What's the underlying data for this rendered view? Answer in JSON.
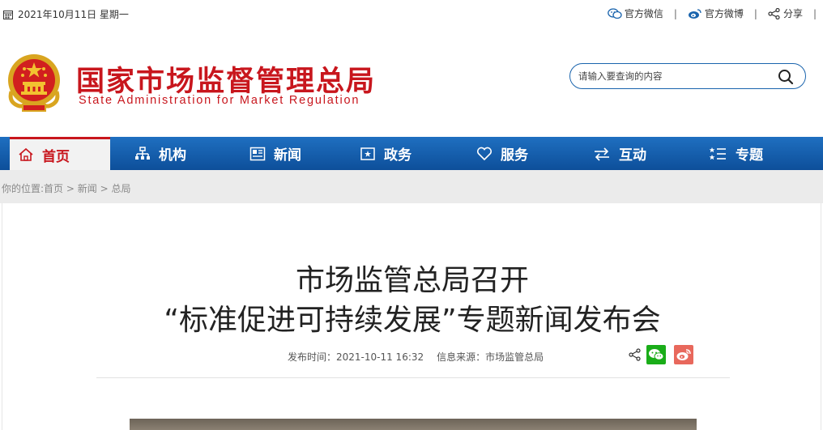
{
  "topbar": {
    "date": "2021年10月11日 星期一",
    "links": [
      {
        "label": "官方微信",
        "icon": "wechat-icon"
      },
      {
        "label": "官方微博",
        "icon": "weibo-icon"
      },
      {
        "label": "分享",
        "icon": "share-icon"
      }
    ],
    "separator": "|"
  },
  "header": {
    "title_cn": "国家市场监督管理总局",
    "title_en": "State Administration for Market Regulation",
    "search_placeholder": "请输入要查询的内容"
  },
  "nav": {
    "items": [
      {
        "label": "首页",
        "icon": "home-icon",
        "active": true
      },
      {
        "label": "机构",
        "icon": "org-icon"
      },
      {
        "label": "新闻",
        "icon": "news-icon"
      },
      {
        "label": "政务",
        "icon": "gov-icon"
      },
      {
        "label": "服务",
        "icon": "heart-icon"
      },
      {
        "label": "互动",
        "icon": "exchange-icon"
      },
      {
        "label": "专题",
        "icon": "topic-icon"
      }
    ]
  },
  "breadcrumb": {
    "prefix": "你的位置:",
    "items": [
      "首页",
      "新闻",
      "总局"
    ],
    "sep": ">"
  },
  "article": {
    "title_line1": "市场监管总局召开",
    "title_line2": "“标准促进可持续发展”专题新闻发布会",
    "publish_label": "发布时间：2021-10-11 16:32",
    "source_label": "信息来源：市场监管总局"
  },
  "colors": {
    "brand_red": "#c8161d",
    "nav_blue": "#1a5fa8",
    "wechat_green": "#1aad19",
    "weibo_red": "#e8685c"
  }
}
